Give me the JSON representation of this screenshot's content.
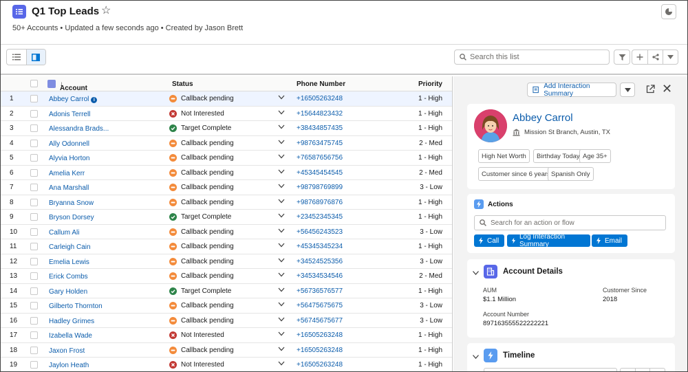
{
  "header": {
    "title": "Q1 Top Leads",
    "meta": "50+ Accounts •  Updated a few seconds ago  • Created by Jason Brett"
  },
  "toolbar": {
    "search_placeholder": "Search this list"
  },
  "table": {
    "columns": {
      "account": "Account",
      "status": "Status",
      "phone": "Phone Number",
      "priority": "Priority"
    },
    "rows": [
      {
        "num": "1",
        "account": "Abbey Carrol",
        "status": "Callback pending",
        "status_type": "pending",
        "phone": "+16505263248",
        "priority": "1 - High"
      },
      {
        "num": "2",
        "account": "Adonis Terrell",
        "status": "Not Interested",
        "status_type": "not",
        "phone": "+15644823432",
        "priority": "1 - High"
      },
      {
        "num": "3",
        "account": "Alessandra Brads...",
        "status": "Target Complete",
        "status_type": "complete",
        "phone": "+38434857435",
        "priority": "1 - High"
      },
      {
        "num": "4",
        "account": "Ally Odonnell",
        "status": "Callback pending",
        "status_type": "pending",
        "phone": "+98763475745",
        "priority": "2 - Med"
      },
      {
        "num": "5",
        "account": "Alyvia Horton",
        "status": "Callback pending",
        "status_type": "pending",
        "phone": "+76587656756",
        "priority": "1 - High"
      },
      {
        "num": "6",
        "account": "Amelia Kerr",
        "status": "Callback pending",
        "status_type": "pending",
        "phone": "+45345454545",
        "priority": "2 - Med"
      },
      {
        "num": "7",
        "account": "Ana Marshall",
        "status": "Callback pending",
        "status_type": "pending",
        "phone": "+98798769899",
        "priority": "3 - Low"
      },
      {
        "num": "8",
        "account": "Bryanna Snow",
        "status": "Callback pending",
        "status_type": "pending",
        "phone": "+98768976876",
        "priority": "1 - High"
      },
      {
        "num": "9",
        "account": "Bryson Dorsey",
        "status": "Target Complete",
        "status_type": "complete",
        "phone": "+23452345345",
        "priority": "1 - High"
      },
      {
        "num": "10",
        "account": "Callum Ali",
        "status": "Callback pending",
        "status_type": "pending",
        "phone": "+56456243523",
        "priority": "3 - Low"
      },
      {
        "num": "11",
        "account": "Carleigh Cain",
        "status": "Callback pending",
        "status_type": "pending",
        "phone": "+45345345234",
        "priority": "1 - High"
      },
      {
        "num": "12",
        "account": "Emelia Lewis",
        "status": "Callback pending",
        "status_type": "pending",
        "phone": "+34524525356",
        "priority": "3 - Low"
      },
      {
        "num": "13",
        "account": "Erick Combs",
        "status": "Callback pending",
        "status_type": "pending",
        "phone": "+34534534546",
        "priority": "2 - Med"
      },
      {
        "num": "14",
        "account": "Gary Holden",
        "status": "Target Complete",
        "status_type": "complete",
        "phone": "+56736576577",
        "priority": "1 - High"
      },
      {
        "num": "15",
        "account": "Gilberto Thornton",
        "status": "Callback pending",
        "status_type": "pending",
        "phone": "+56475675675",
        "priority": "3 - Low"
      },
      {
        "num": "16",
        "account": "Hadley Grimes",
        "status": "Callback pending",
        "status_type": "pending",
        "phone": "+56745675677",
        "priority": "3 - Low"
      },
      {
        "num": "17",
        "account": "Izabella Wade",
        "status": "Not Interested",
        "status_type": "not",
        "phone": "+16505263248",
        "priority": "1 - High"
      },
      {
        "num": "18",
        "account": "Jaxon Frost",
        "status": "Callback pending",
        "status_type": "pending",
        "phone": "+16505263248",
        "priority": "1 - High"
      },
      {
        "num": "19",
        "account": "Jaylon Heath",
        "status": "Not Interested",
        "status_type": "not",
        "phone": "+16505263248",
        "priority": "1 - High"
      }
    ]
  },
  "panel": {
    "add_button": "Add Interaction Summary",
    "profile": {
      "name": "Abbey Carrol",
      "branch": "Mission St Branch, Austin, TX",
      "tags": [
        "High Net Worth",
        "Birthday Today",
        "Age 35+",
        "Customer since 6 years",
        "Spanish Only"
      ]
    },
    "actions": {
      "title": "Actions",
      "search_placeholder": "Search for an action or flow",
      "buttons": [
        "Call",
        "Log Interaction Summary",
        "Email"
      ]
    },
    "details": {
      "title": "Account Details",
      "aum_label": "AUM",
      "aum_value": "$1.1 Million",
      "since_label": "Customer Since",
      "since_value": "2018",
      "acct_label": "Account Number",
      "acct_value": "897163555522222221"
    },
    "timeline": {
      "title": "Timeline"
    }
  },
  "colors": {
    "link": "#0b5cab",
    "brand": "#0176d3",
    "pending": "#f38b3b",
    "not": "#c23934",
    "complete": "#2e844a"
  }
}
